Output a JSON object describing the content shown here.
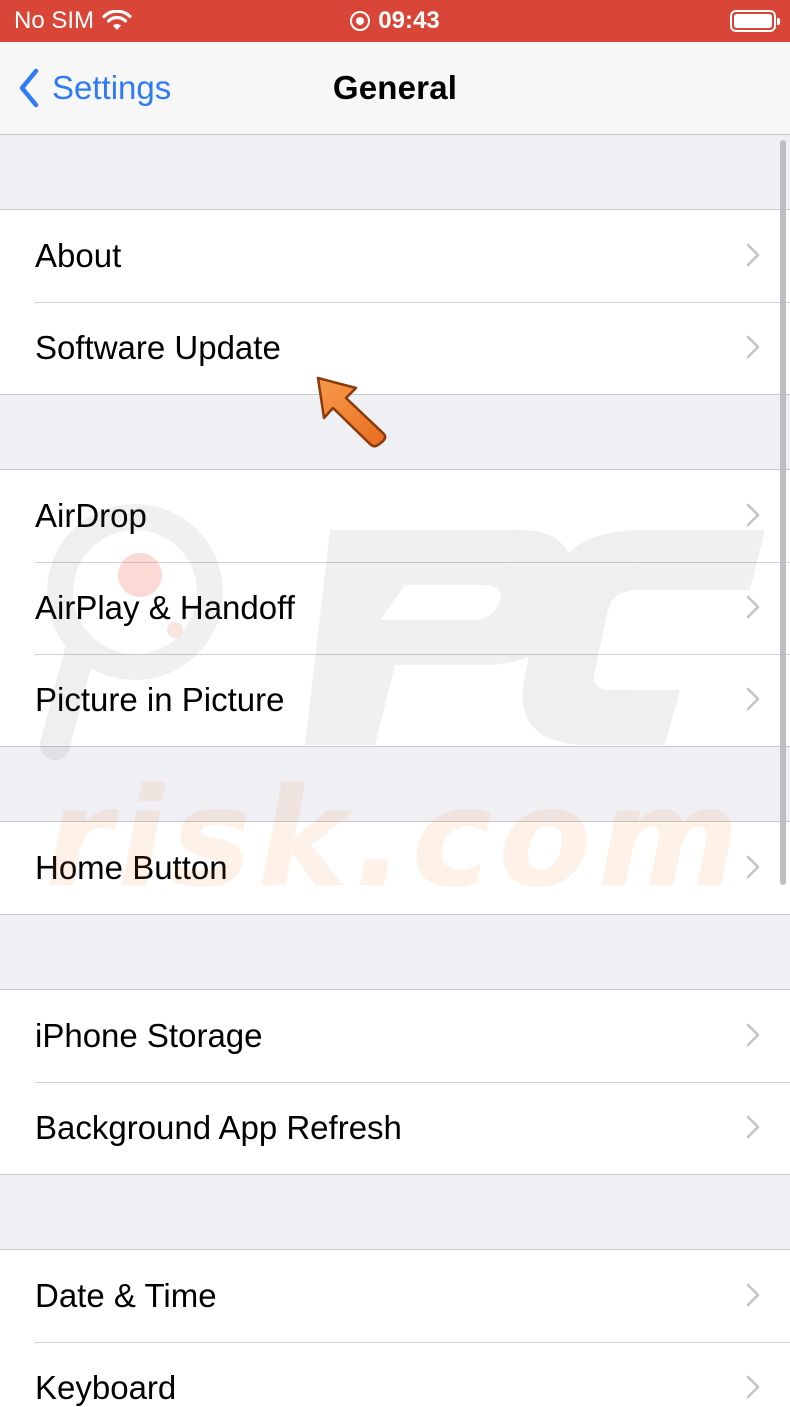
{
  "status_bar": {
    "carrier": "No SIM",
    "time": "09:43",
    "colors": {
      "background": "#d94638"
    }
  },
  "nav": {
    "back_label": "Settings",
    "title": "General",
    "accent": "#2f7bf5"
  },
  "groups": [
    {
      "items": [
        {
          "label": "About"
        },
        {
          "label": "Software Update"
        }
      ]
    },
    {
      "items": [
        {
          "label": "AirDrop"
        },
        {
          "label": "AirPlay & Handoff"
        },
        {
          "label": "Picture in Picture"
        }
      ]
    },
    {
      "items": [
        {
          "label": "Home Button"
        }
      ]
    },
    {
      "items": [
        {
          "label": "iPhone Storage"
        },
        {
          "label": "Background App Refresh"
        }
      ]
    },
    {
      "items": [
        {
          "label": "Date & Time"
        },
        {
          "label": "Keyboard"
        }
      ]
    }
  ],
  "watermark": {
    "line1": "PC",
    "line2": "risk.com"
  },
  "annotation": {
    "icon": "pointer-arrow-icon",
    "color": "#f07f2e",
    "target": "Software Update"
  }
}
